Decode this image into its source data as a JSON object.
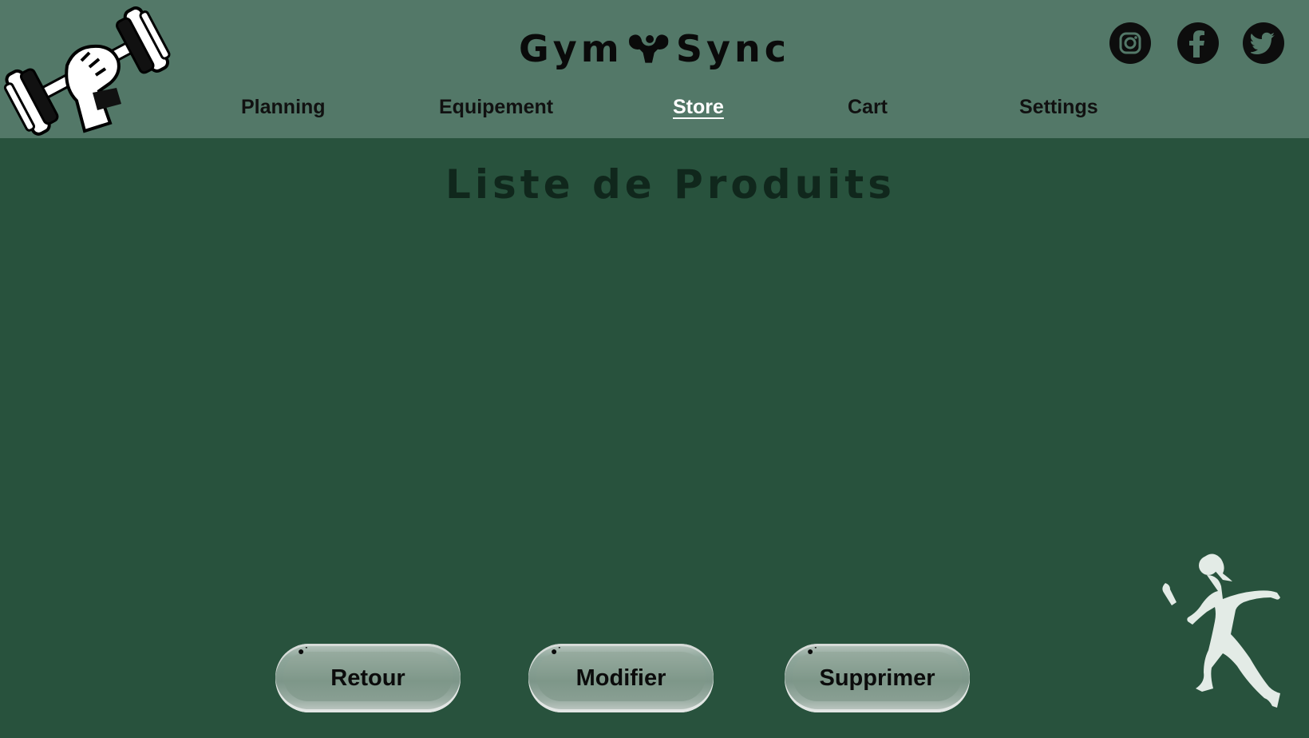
{
  "header": {
    "brand_left": "Gym",
    "brand_right": "Sync",
    "nav": [
      {
        "label": "Planning"
      },
      {
        "label": "Equipement"
      },
      {
        "label": "Store"
      },
      {
        "label": "Cart"
      },
      {
        "label": "Settings"
      }
    ],
    "active_nav": "Store",
    "social": [
      "instagram-icon",
      "facebook-icon",
      "twitter-icon"
    ]
  },
  "main": {
    "title": "Liste de Produits"
  },
  "actions": {
    "back_label": "Retour",
    "edit_label": "Modifier",
    "delete_label": "Supprimer"
  },
  "colors": {
    "header_bg": "#537868",
    "page_bg": "#28523d",
    "active_nav": "#ffffff",
    "runner": "#e3ebe6"
  }
}
